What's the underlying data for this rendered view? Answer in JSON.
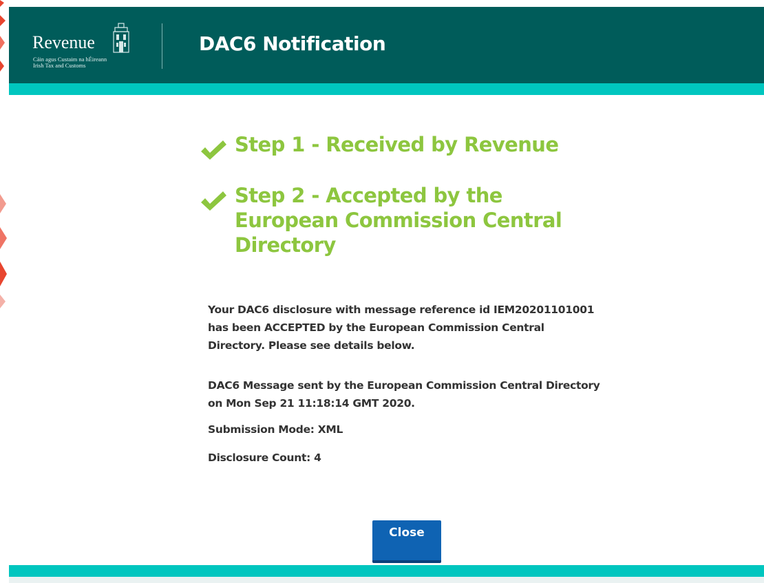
{
  "header": {
    "logo_word": "Revenue",
    "logo_sub_line1": "Cáin agus Custaim na hÉireann",
    "logo_sub_line2": "Irish Tax and Customs",
    "title": "DAC6 Notification",
    "background_color": "#005c5a",
    "stripe_color": "#00c6bf"
  },
  "steps": [
    {
      "label": "Step 1 - Received by Revenue",
      "icon": "check-icon",
      "status": "complete"
    },
    {
      "label_line1": "Step 2 - Accepted by the",
      "label_line2": "European Commission Central",
      "label_line3": "Directory",
      "icon": "check-icon",
      "status": "complete"
    }
  ],
  "messages": {
    "acceptance_line1": "Your DAC6 disclosure with message reference id IEM20201101001",
    "acceptance_line2": "has been ACCEPTED by the European Commission Central",
    "acceptance_line3": "Directory. Please see details below.",
    "sent_line1": "DAC6 Message sent by the European Commission Central Directory",
    "sent_line2": "on Mon Sep 21 11:18:14 GMT 2020.",
    "submission_mode": "Submission Mode: XML",
    "disclosure_count": "Disclosure Count: 4"
  },
  "actions": {
    "close_label": "Close",
    "close_color": "#0f63b3"
  },
  "colors": {
    "step_green": "#8dc63f",
    "body_text": "#333333"
  }
}
